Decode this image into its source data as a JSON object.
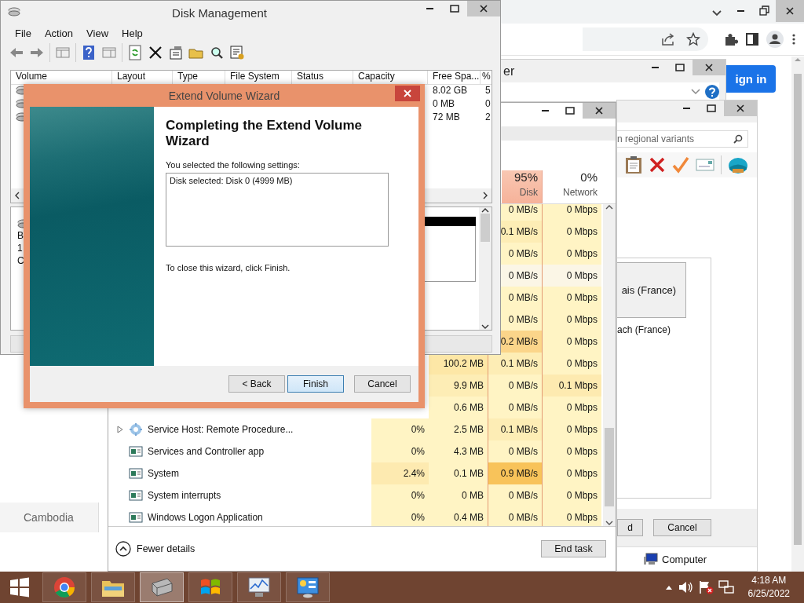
{
  "browser": {
    "sign_in": "ign in",
    "list_item": "Cambodia"
  },
  "help_window": {
    "title": "er"
  },
  "region_window": {
    "search_placeholder": "n regional variants",
    "option": "ais (France)",
    "option_caption": "ach (France)",
    "buttons": [
      "d",
      "Cancel"
    ],
    "status": "Computer"
  },
  "task_manager": {
    "columns": [
      {
        "value": "95%",
        "label": "Disk",
        "selected": true
      },
      {
        "value": "0%",
        "label": "Network",
        "selected": false
      }
    ],
    "rows": [
      {
        "expandable": false,
        "hovered": false,
        "disk": "0 MB/s",
        "network": "0 Mbps"
      },
      {
        "expandable": false,
        "hovered": false,
        "disk": "0.1 MB/s",
        "network": "0 Mbps"
      },
      {
        "expandable": false,
        "hovered": false,
        "disk": "0 MB/s",
        "network": "0 Mbps"
      },
      {
        "expandable": false,
        "hovered": true,
        "disk": "0 MB/s",
        "network": "0 Mbps"
      },
      {
        "expandable": false,
        "hovered": false,
        "disk": "0 MB/s",
        "network": "0 Mbps"
      },
      {
        "expandable": false,
        "hovered": false,
        "disk": "0 MB/s",
        "network": "0 Mbps"
      },
      {
        "expandable": false,
        "hovered": false,
        "disk": "0.2 MB/s",
        "network": "0 Mbps"
      },
      {
        "expandable": false,
        "hovered": false,
        "memory": "100.2 MB",
        "disk": "0.1 MB/s",
        "network": "0 Mbps"
      },
      {
        "expandable": false,
        "hovered": false,
        "memory": "9.9 MB",
        "disk": "0 MB/s",
        "network": "0.1 Mbps"
      },
      {
        "expandable": false,
        "hovered": false,
        "memory": "0.6 MB",
        "disk": "0 MB/s",
        "network": "0 Mbps"
      },
      {
        "name": "Service Host: Remote Procedure...",
        "kind": "service",
        "expandable": true,
        "hovered": false,
        "cpu": "0%",
        "memory": "2.5 MB",
        "disk": "0.1 MB/s",
        "network": "0 Mbps"
      },
      {
        "name": "Services and Controller app",
        "kind": "app",
        "expandable": false,
        "hovered": false,
        "cpu": "0%",
        "memory": "4.3 MB",
        "disk": "0 MB/s",
        "network": "0 Mbps"
      },
      {
        "name": "System",
        "kind": "app",
        "expandable": false,
        "hovered": false,
        "cpu": "2.4%",
        "memory": "0.1 MB",
        "disk": "0.9 MB/s",
        "network": "0 Mbps"
      },
      {
        "name": "System interrupts",
        "kind": "app",
        "expandable": false,
        "hovered": false,
        "cpu": "0%",
        "memory": "0 MB",
        "disk": "0 MB/s",
        "network": "0 Mbps"
      },
      {
        "name": "Windows Logon Application",
        "kind": "app",
        "expandable": false,
        "hovered": false,
        "cpu": "0%",
        "memory": "0.4 MB",
        "disk": "0 MB/s",
        "network": "0 Mbps"
      }
    ],
    "footer": {
      "toggle": "Fewer details",
      "end_task": "End task"
    }
  },
  "disk_management": {
    "title": "Disk Management",
    "menu": [
      "File",
      "Action",
      "View",
      "Help"
    ],
    "columns": [
      "Volume",
      "Layout",
      "Type",
      "File System",
      "Status",
      "Capacity",
      "Free Spa...",
      "%"
    ],
    "rows": [
      {
        "free_space": "8.02 GB",
        "percent": "5"
      },
      {
        "free_space": "0 MB",
        "percent": "0"
      },
      {
        "free_space": "72 MB",
        "percent": "2"
      }
    ],
    "disk_labels": [
      "B",
      "1",
      "C"
    ]
  },
  "wizard": {
    "title": "Extend Volume Wizard",
    "heading": "Completing the Extend Volume Wizard",
    "settings_label": "You selected the following settings:",
    "settings": [
      "Disk selected: Disk 0 (4999 MB)"
    ],
    "closing": "To close this wizard, click Finish.",
    "buttons": [
      {
        "label": "< Back",
        "default": false
      },
      {
        "label": "Finish",
        "default": true
      },
      {
        "label": "Cancel",
        "default": false
      }
    ]
  },
  "taskbar": {
    "apps": [
      {
        "kind": "chrome",
        "active": false
      },
      {
        "kind": "explorer",
        "active": false
      },
      {
        "kind": "disk",
        "active": true
      },
      {
        "kind": "windows",
        "active": false
      },
      {
        "kind": "monitor",
        "active": false
      },
      {
        "kind": "control",
        "active": false
      }
    ],
    "time": "4:18 AM",
    "date": "6/25/2022"
  }
}
